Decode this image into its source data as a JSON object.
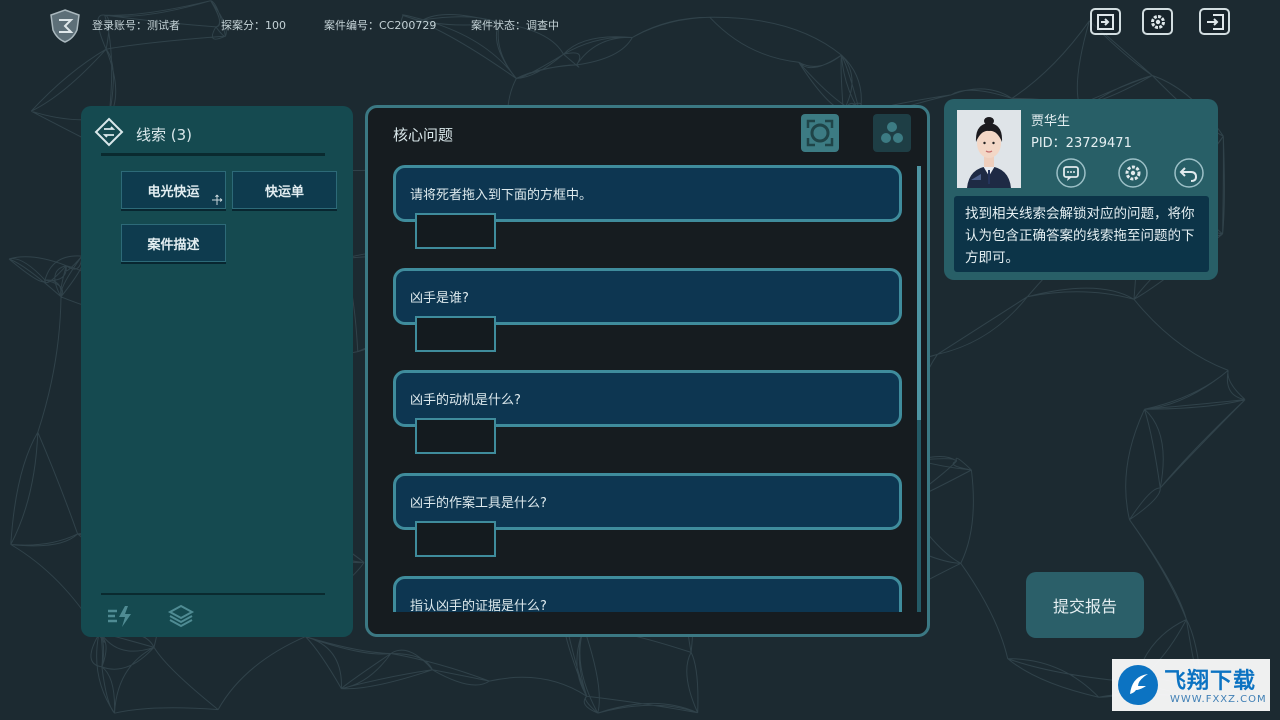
{
  "header": {
    "account": "登录账号：测试者",
    "score": "探案分：100",
    "case_number": "案件编号：CC200729",
    "case_status": "案件状态：调查中"
  },
  "top_buttons": [
    "exit-icon",
    "gear-icon",
    "logout-icon"
  ],
  "clues": {
    "title": "线索 (3)",
    "items": [
      {
        "label": "电光快运"
      },
      {
        "label": "快运单"
      },
      {
        "label": "案件描述"
      }
    ],
    "footer_icons": [
      "flash-icon",
      "layers-icon"
    ]
  },
  "core": {
    "title": "核心问题",
    "questions": [
      {
        "text": "请将死者拖入到下面的方框中。"
      },
      {
        "text": "凶手是谁?"
      },
      {
        "text": "凶手的动机是什么?"
      },
      {
        "text": "凶手的作案工具是什么?"
      },
      {
        "text": "指认凶手的证据是什么?"
      }
    ]
  },
  "officer": {
    "name": "贾华生",
    "pid": "PID：23729471",
    "hint": "找到相关线索会解锁对应的问题，将你认为包含正确答案的线索拖至问题的下方即可。",
    "icons": [
      "chat-icon",
      "gear-icon",
      "back-icon"
    ]
  },
  "submit": {
    "label": "提交报告"
  },
  "watermark": {
    "text": "飞翔下载",
    "url": "WWW.FXXZ.COM"
  },
  "colors": {
    "panel_teal": "#154a50",
    "question_card": "#0d3651",
    "card_border": "#3f8c9c",
    "officer_card": "#285f67"
  }
}
